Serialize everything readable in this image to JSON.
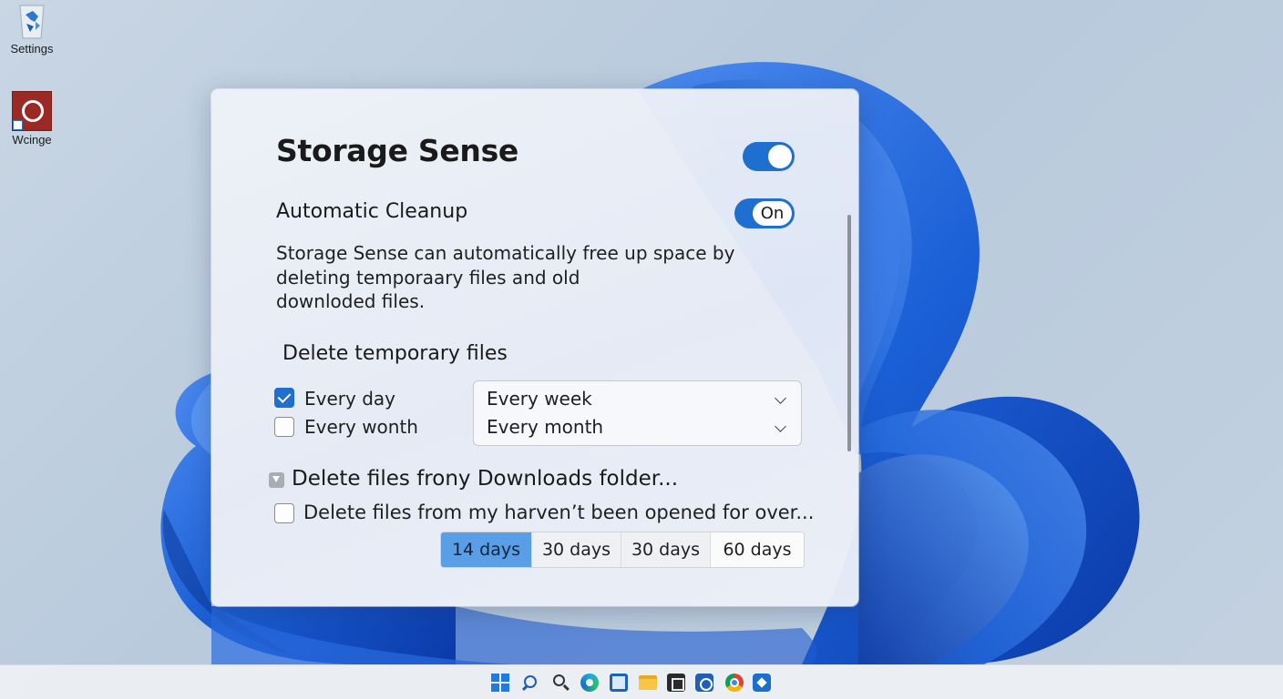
{
  "desktop": {
    "icons": [
      {
        "label": "Settings",
        "icon": "settings-recycle-icon"
      },
      {
        "label": "Wcinge",
        "icon": "app-circle-icon"
      }
    ]
  },
  "panel": {
    "title": "Storage Sense",
    "title_toggle_state": "on",
    "auto_cleanup": {
      "label": "Automatic Cleanup",
      "toggle_text": "On"
    },
    "description_lines": [
      "Storage Sense can automatically free up space by",
      "deleting temporaary files and old",
      "downloded files."
    ],
    "temp_section": {
      "heading": "Delete temporary files",
      "options": [
        {
          "label": "Every day",
          "checked": true
        },
        {
          "label": "Every wonth",
          "checked": false
        }
      ],
      "dropdowns": [
        {
          "value": "Every week"
        },
        {
          "value": "Every month"
        }
      ]
    },
    "downloads_section": {
      "heading": "Delete files frony Downloads folder...",
      "option_label": "Delete files from my harven’t been opened for over...",
      "option_checked": false,
      "durations": [
        "14 days",
        "30 days",
        "30 days",
        "60 days"
      ],
      "selected_duration_index": 0
    }
  },
  "taskbar": {
    "icons": [
      "start-icon",
      "search-icon",
      "search-icon",
      "edge-icon",
      "store-icon",
      "file-explorer-icon",
      "terminal-icon",
      "security-icon",
      "chrome-icon",
      "app-icon"
    ]
  },
  "colors": {
    "accent": "#1f6fd1",
    "selected_segment": "#5a9ee6",
    "wallpaper_blue": "#1b5fd6"
  }
}
